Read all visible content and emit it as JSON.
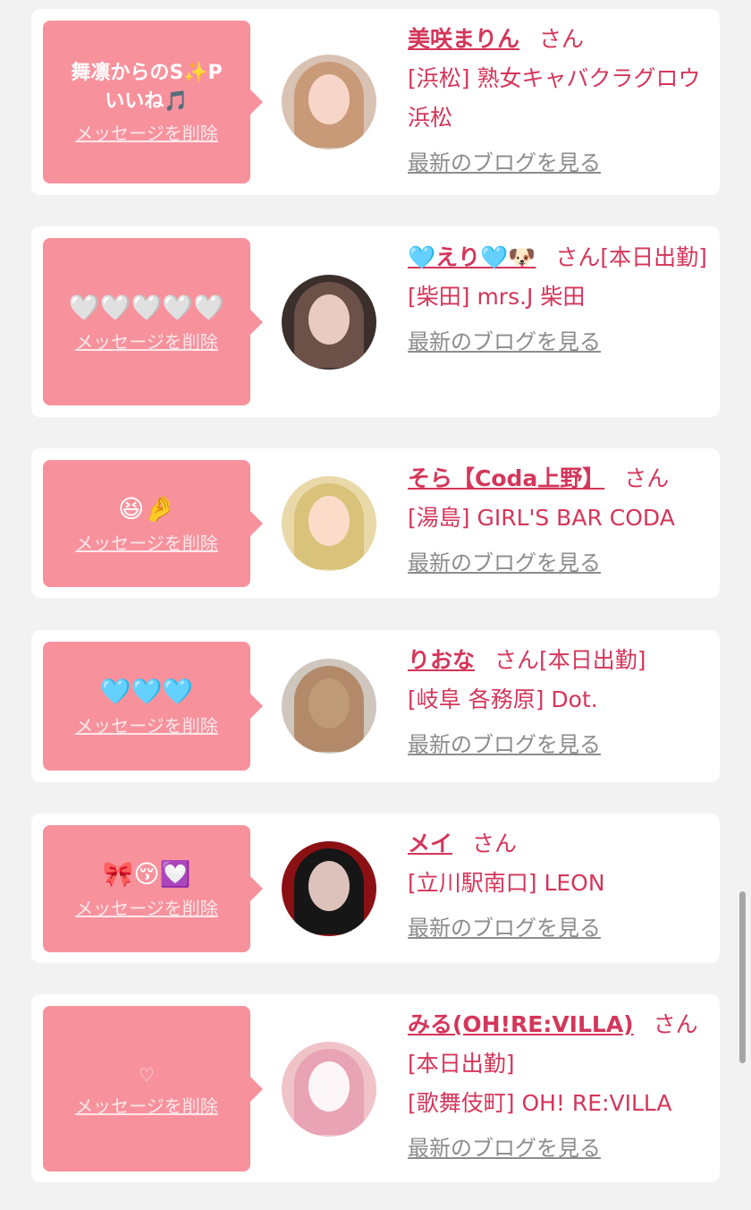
{
  "colors": {
    "page_bg": "#f2f2f2",
    "card_bg": "#ffffff",
    "bubble_bg": "#f7929d",
    "name_color": "#d4365a",
    "link_gray": "#8c8c8c"
  },
  "labels": {
    "delete_message": "メッセージを削除",
    "view_blog": "最新のブログを見る",
    "honorific": "さん"
  },
  "entries": [
    {
      "message": "舞凛からのS✨P\nいいね🎵",
      "name": "美咲まりん",
      "status": "",
      "shop": "[浜松] 熟女キャバクラグロウ 浜松",
      "avatar_colors": [
        "#d8c2b4",
        "#c99a78"
      ]
    },
    {
      "message": "🤍🤍🤍🤍🤍",
      "name": "🩵えり🩵🐶",
      "status": "[本日出勤]",
      "shop": "[柴田] mrs.J 柴田",
      "avatar_colors": [
        "#3b2f2c",
        "#6b5148"
      ]
    },
    {
      "message": "😆🤌",
      "name": "そら【Coda上野】",
      "status": "",
      "shop": "[湯島] GIRL'S BAR CODA",
      "avatar_colors": [
        "#e9d9a8",
        "#d9c27a"
      ]
    },
    {
      "message": "🩵🩵🩵",
      "name": "りおな",
      "status": "[本日出勤]",
      "shop": "[岐阜 各務原] Dot.",
      "avatar_colors": [
        "#cfc6bd",
        "#b28a6a"
      ]
    },
    {
      "message": "🎀😚💟",
      "name": "メイ",
      "status": "",
      "shop": "[立川駅南口] LEON",
      "avatar_colors": [
        "#8a1014",
        "#161616"
      ]
    },
    {
      "message": "♡",
      "name": "みる(OH!RE:VILLA)",
      "status": "[本日出勤]",
      "shop": "[歌舞伎町] OH! RE:VILLA",
      "avatar_colors": [
        "#f0c3c8",
        "#e8a3b4"
      ]
    }
  ]
}
